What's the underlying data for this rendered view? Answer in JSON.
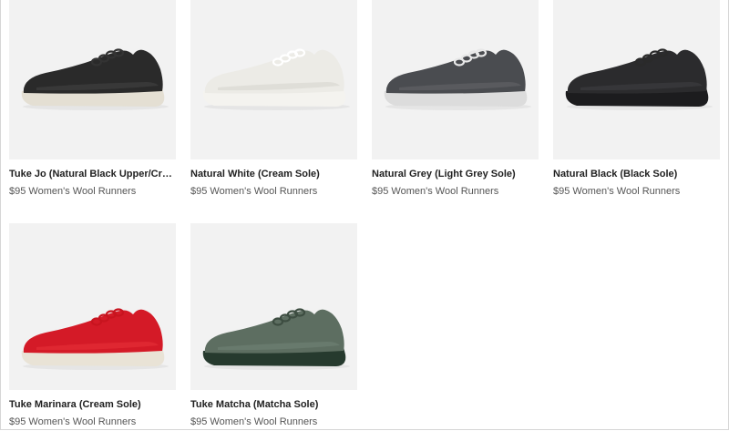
{
  "products": [
    {
      "name": "Tuke Jo (Natural Black Upper/Cream Sole)",
      "price": "$95",
      "category": "Women's Wool Runners",
      "upper_color": "#2a2a2a",
      "upper_shade": "#3c3c3c",
      "sole_color": "#e4dfd3",
      "lace_color": "#333333",
      "icon": "shoe-image"
    },
    {
      "name": "Natural White (Cream Sole)",
      "price": "$95",
      "category": "Women's Wool Runners",
      "upper_color": "#ecebe6",
      "upper_shade": "#dcdbd5",
      "sole_color": "#f4f3ef",
      "lace_color": "#ffffff",
      "icon": "shoe-image"
    },
    {
      "name": "Natural Grey (Light Grey Sole)",
      "price": "$95",
      "category": "Women's Wool Runners",
      "upper_color": "#4a4c50",
      "upper_shade": "#5c5e62",
      "sole_color": "#dcdcdc",
      "lace_color": "#e8e8e8",
      "icon": "shoe-image"
    },
    {
      "name": "Natural Black (Black Sole)",
      "price": "$95",
      "category": "Women's Wool Runners",
      "upper_color": "#2b2b2d",
      "upper_shade": "#3a3a3c",
      "sole_color": "#1c1c1e",
      "lace_color": "#2a2a2a",
      "icon": "shoe-image"
    },
    {
      "name": "Tuke Marinara (Cream Sole)",
      "price": "$95",
      "category": "Women's Wool Runners",
      "upper_color": "#d41a27",
      "upper_shade": "#e12a35",
      "sole_color": "#e9e3d6",
      "lace_color": "#c8141f",
      "icon": "shoe-image"
    },
    {
      "name": "Tuke Matcha (Matcha Sole)",
      "price": "$95",
      "category": "Women's Wool Runners",
      "upper_color": "#5d6e61",
      "upper_shade": "#6c7d70",
      "sole_color": "#263a2e",
      "lace_color": "#3d4d41",
      "icon": "shoe-image"
    }
  ]
}
